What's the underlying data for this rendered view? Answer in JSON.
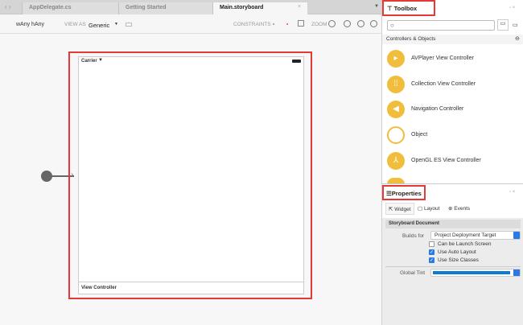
{
  "tabs": [
    {
      "label": "AppDelegate.cs"
    },
    {
      "label": "Getting Started"
    },
    {
      "label": "Main.storyboard",
      "active": true
    }
  ],
  "toolbar": {
    "size_class": "wAny hAny",
    "view_as_label": "VIEW AS",
    "view_as_value": "Generic",
    "constraints_label": "CONSTRAINTS",
    "zoom_label": "ZOOM"
  },
  "canvas": {
    "status_carrier": "Carrier",
    "scene_label": "View Controller"
  },
  "toolbox": {
    "title": "Toolbox",
    "search_placeholder": "",
    "section": "Controllers & Objects",
    "items": [
      {
        "label": "AVPlayer View Controller",
        "icon": "avplayer-icon"
      },
      {
        "label": "Collection View Controller",
        "icon": "grid-icon"
      },
      {
        "label": "Navigation Controller",
        "icon": "navigation-icon"
      },
      {
        "label": "Object",
        "icon": "object-icon"
      },
      {
        "label": "OpenGL ES View Controller",
        "icon": "opengl-icon"
      }
    ]
  },
  "properties": {
    "title": "Properties",
    "tabs": [
      {
        "label": "Widget"
      },
      {
        "label": "Layout"
      },
      {
        "label": "Events"
      }
    ],
    "section": "Storyboard Document",
    "builds_for_label": "Builds for",
    "builds_for_value": "Project Deployment Target",
    "checkboxes": [
      {
        "label": "Can be Launch Screen",
        "checked": false
      },
      {
        "label": "Use Auto Layout",
        "checked": true
      },
      {
        "label": "Use Size Classes",
        "checked": true
      }
    ],
    "global_tint_label": "Global Tint",
    "global_tint_color": "#0a7bd6"
  },
  "colors": {
    "accent_red": "#e53935",
    "toolbox_icon": "#f0be3c"
  }
}
